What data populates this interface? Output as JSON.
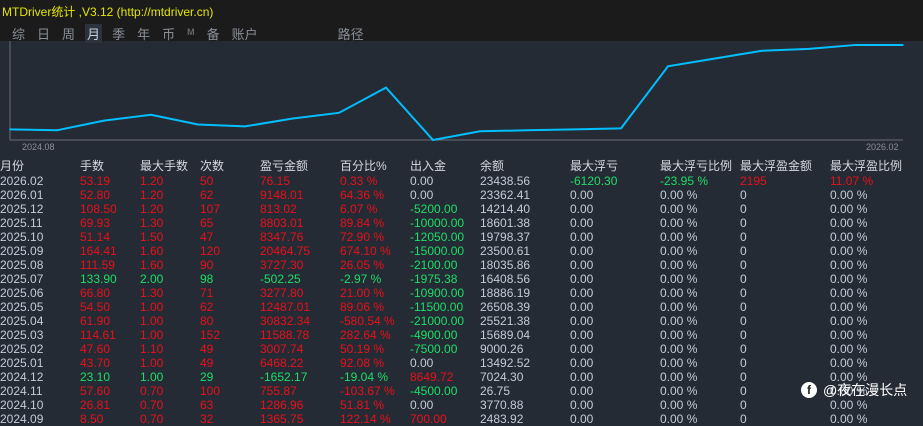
{
  "window": {
    "title": "MTDriver统计 ,V3.12 (http://mtdriver.cn)"
  },
  "nav": {
    "items": [
      "综",
      "日",
      "周",
      "月",
      "季",
      "年",
      "币",
      "M",
      "备",
      "账户"
    ],
    "active": "月",
    "path_label": "路径"
  },
  "chart_data": {
    "type": "line",
    "title": "",
    "x_start_label": "2024.08",
    "x_end_label": "2026.02",
    "series": [
      {
        "name": "balance-curve",
        "color": "#00bfff",
        "values": [
          11,
          10,
          20,
          26,
          16,
          14,
          22,
          28,
          54,
          0,
          9,
          10,
          11,
          12,
          76,
          84,
          92,
          94,
          98,
          98
        ]
      }
    ],
    "ylim": [
      0,
      100
    ]
  },
  "table": {
    "headers": [
      "月份",
      "手数",
      "最大手数",
      "次数",
      "盈亏金额",
      "百分比%",
      "出入金",
      "余额",
      "最大浮亏",
      "最大浮亏比例",
      "最大浮盈金额",
      "最大浮盈比例"
    ],
    "rows": [
      [
        [
          "2026.02",
          "n"
        ],
        [
          "53.19",
          "r"
        ],
        [
          "1.20",
          "r"
        ],
        [
          "50",
          "r"
        ],
        [
          "76.15",
          "r"
        ],
        [
          "0.33 %",
          "r"
        ],
        [
          "0.00",
          "n"
        ],
        [
          "23438.56",
          "n"
        ],
        [
          "-6120.30",
          "g"
        ],
        [
          "-23.95 %",
          "g"
        ],
        [
          "2195",
          "r"
        ],
        [
          "11.07 %",
          "r"
        ]
      ],
      [
        [
          "2026.01",
          "n"
        ],
        [
          "52.80",
          "r"
        ],
        [
          "1.20",
          "r"
        ],
        [
          "62",
          "r"
        ],
        [
          "9148.01",
          "r"
        ],
        [
          "64.36 %",
          "r"
        ],
        [
          "0.00",
          "n"
        ],
        [
          "23362.41",
          "n"
        ],
        [
          "0.00",
          "n"
        ],
        [
          "0.00 %",
          "n"
        ],
        [
          "0",
          "n"
        ],
        [
          "0.00 %",
          "n"
        ]
      ],
      [
        [
          "2025.12",
          "n"
        ],
        [
          "108.50",
          "r"
        ],
        [
          "1.20",
          "r"
        ],
        [
          "107",
          "r"
        ],
        [
          "813.02",
          "r"
        ],
        [
          "6.07 %",
          "r"
        ],
        [
          "-5200.00",
          "g"
        ],
        [
          "14214.40",
          "n"
        ],
        [
          "0.00",
          "n"
        ],
        [
          "0.00 %",
          "n"
        ],
        [
          "0",
          "n"
        ],
        [
          "0.00 %",
          "n"
        ]
      ],
      [
        [
          "2025.11",
          "n"
        ],
        [
          "69.93",
          "r"
        ],
        [
          "1.30",
          "r"
        ],
        [
          "65",
          "r"
        ],
        [
          "8803.01",
          "r"
        ],
        [
          "89.84 %",
          "r"
        ],
        [
          "-10000.00",
          "g"
        ],
        [
          "18601.38",
          "n"
        ],
        [
          "0.00",
          "n"
        ],
        [
          "0.00 %",
          "n"
        ],
        [
          "0",
          "n"
        ],
        [
          "0.00 %",
          "n"
        ]
      ],
      [
        [
          "2025.10",
          "n"
        ],
        [
          "51.14",
          "r"
        ],
        [
          "1.50",
          "r"
        ],
        [
          "47",
          "r"
        ],
        [
          "8347.76",
          "r"
        ],
        [
          "72.90 %",
          "r"
        ],
        [
          "-12050.00",
          "g"
        ],
        [
          "19798.37",
          "n"
        ],
        [
          "0.00",
          "n"
        ],
        [
          "0.00 %",
          "n"
        ],
        [
          "0",
          "n"
        ],
        [
          "0.00 %",
          "n"
        ]
      ],
      [
        [
          "2025.09",
          "n"
        ],
        [
          "164.41",
          "r"
        ],
        [
          "1.60",
          "r"
        ],
        [
          "120",
          "r"
        ],
        [
          "20464.75",
          "r"
        ],
        [
          "674.10 %",
          "r"
        ],
        [
          "-15000.00",
          "g"
        ],
        [
          "23500.61",
          "n"
        ],
        [
          "0.00",
          "n"
        ],
        [
          "0.00 %",
          "n"
        ],
        [
          "0",
          "n"
        ],
        [
          "0.00 %",
          "n"
        ]
      ],
      [
        [
          "2025.08",
          "n"
        ],
        [
          "111.59",
          "r"
        ],
        [
          "1.60",
          "r"
        ],
        [
          "90",
          "r"
        ],
        [
          "3727.30",
          "r"
        ],
        [
          "26.05 %",
          "r"
        ],
        [
          "-2100.00",
          "g"
        ],
        [
          "18035.86",
          "n"
        ],
        [
          "0.00",
          "n"
        ],
        [
          "0.00 %",
          "n"
        ],
        [
          "0",
          "n"
        ],
        [
          "0.00 %",
          "n"
        ]
      ],
      [
        [
          "2025.07",
          "n"
        ],
        [
          "133.90",
          "g"
        ],
        [
          "2.00",
          "g"
        ],
        [
          "98",
          "g"
        ],
        [
          "-502.25",
          "g"
        ],
        [
          "-2.97 %",
          "g"
        ],
        [
          "-1975.38",
          "g"
        ],
        [
          "16408.56",
          "n"
        ],
        [
          "0.00",
          "n"
        ],
        [
          "0.00 %",
          "n"
        ],
        [
          "0",
          "n"
        ],
        [
          "0.00 %",
          "n"
        ]
      ],
      [
        [
          "2025.06",
          "n"
        ],
        [
          "66.80",
          "r"
        ],
        [
          "1.30",
          "r"
        ],
        [
          "71",
          "r"
        ],
        [
          "3277.80",
          "r"
        ],
        [
          "21.00 %",
          "r"
        ],
        [
          "-10900.00",
          "g"
        ],
        [
          "18886.19",
          "n"
        ],
        [
          "0.00",
          "n"
        ],
        [
          "0.00 %",
          "n"
        ],
        [
          "0",
          "n"
        ],
        [
          "0.00 %",
          "n"
        ]
      ],
      [
        [
          "2025.05",
          "n"
        ],
        [
          "54.50",
          "r"
        ],
        [
          "1.00",
          "r"
        ],
        [
          "62",
          "r"
        ],
        [
          "12487.01",
          "r"
        ],
        [
          "89.06 %",
          "r"
        ],
        [
          "-11500.00",
          "g"
        ],
        [
          "26508.39",
          "n"
        ],
        [
          "0.00",
          "n"
        ],
        [
          "0.00 %",
          "n"
        ],
        [
          "0",
          "n"
        ],
        [
          "0.00 %",
          "n"
        ]
      ],
      [
        [
          "2025.04",
          "n"
        ],
        [
          "61.90",
          "r"
        ],
        [
          "1.00",
          "r"
        ],
        [
          "80",
          "r"
        ],
        [
          "30832.34",
          "r"
        ],
        [
          "-580.54 %",
          "r"
        ],
        [
          "-21000.00",
          "g"
        ],
        [
          "25521.38",
          "n"
        ],
        [
          "0.00",
          "n"
        ],
        [
          "0.00 %",
          "n"
        ],
        [
          "0",
          "n"
        ],
        [
          "0.00 %",
          "n"
        ]
      ],
      [
        [
          "2025.03",
          "n"
        ],
        [
          "114.61",
          "r"
        ],
        [
          "1.00",
          "r"
        ],
        [
          "152",
          "r"
        ],
        [
          "11588.78",
          "r"
        ],
        [
          "282.64 %",
          "r"
        ],
        [
          "-4900.00",
          "g"
        ],
        [
          "15689.04",
          "n"
        ],
        [
          "0.00",
          "n"
        ],
        [
          "0.00 %",
          "n"
        ],
        [
          "0",
          "n"
        ],
        [
          "0.00 %",
          "n"
        ]
      ],
      [
        [
          "2025.02",
          "n"
        ],
        [
          "47.60",
          "r"
        ],
        [
          "1.10",
          "r"
        ],
        [
          "49",
          "r"
        ],
        [
          "3007.74",
          "r"
        ],
        [
          "50.19 %",
          "r"
        ],
        [
          "-7500.00",
          "g"
        ],
        [
          "9000.26",
          "n"
        ],
        [
          "0.00",
          "n"
        ],
        [
          "0.00 %",
          "n"
        ],
        [
          "0",
          "n"
        ],
        [
          "0.00 %",
          "n"
        ]
      ],
      [
        [
          "2025.01",
          "n"
        ],
        [
          "43.70",
          "r"
        ],
        [
          "1.00",
          "r"
        ],
        [
          "49",
          "r"
        ],
        [
          "6468.22",
          "r"
        ],
        [
          "92.08 %",
          "r"
        ],
        [
          "0.00",
          "n"
        ],
        [
          "13492.52",
          "n"
        ],
        [
          "0.00",
          "n"
        ],
        [
          "0.00 %",
          "n"
        ],
        [
          "0",
          "n"
        ],
        [
          "0.00 %",
          "n"
        ]
      ],
      [
        [
          "2024.12",
          "n"
        ],
        [
          "23.10",
          "g"
        ],
        [
          "1.00",
          "g"
        ],
        [
          "29",
          "g"
        ],
        [
          "-1652.17",
          "g"
        ],
        [
          "-19.04 %",
          "g"
        ],
        [
          "8649.72",
          "r"
        ],
        [
          "7024.30",
          "n"
        ],
        [
          "0.00",
          "n"
        ],
        [
          "0.00 %",
          "n"
        ],
        [
          "0",
          "n"
        ],
        [
          "0.00 %",
          "n"
        ]
      ],
      [
        [
          "2024.11",
          "n"
        ],
        [
          "57.60",
          "r"
        ],
        [
          "0.70",
          "r"
        ],
        [
          "100",
          "r"
        ],
        [
          "755.87",
          "r"
        ],
        [
          "-103.67 %",
          "r"
        ],
        [
          "-4500.00",
          "g"
        ],
        [
          "26.75",
          "n"
        ],
        [
          "0.00",
          "n"
        ],
        [
          "0.00 %",
          "n"
        ],
        [
          "0",
          "n"
        ],
        [
          "0.00 %",
          "n"
        ]
      ],
      [
        [
          "2024.10",
          "n"
        ],
        [
          "26.81",
          "r"
        ],
        [
          "0.70",
          "r"
        ],
        [
          "63",
          "r"
        ],
        [
          "1286.96",
          "r"
        ],
        [
          "51.81 %",
          "r"
        ],
        [
          "0.00",
          "n"
        ],
        [
          "3770.88",
          "n"
        ],
        [
          "0.00",
          "n"
        ],
        [
          "0.00 %",
          "n"
        ],
        [
          "0",
          "n"
        ],
        [
          "0.00 %",
          "n"
        ]
      ],
      [
        [
          "2024.09",
          "n"
        ],
        [
          "8.50",
          "r"
        ],
        [
          "0.70",
          "r"
        ],
        [
          "32",
          "r"
        ],
        [
          "1365.75",
          "r"
        ],
        [
          "122.14 %",
          "r"
        ],
        [
          "700.00",
          "r"
        ],
        [
          "2483.92",
          "n"
        ],
        [
          "0.00",
          "n"
        ],
        [
          "0.00 %",
          "n"
        ],
        [
          "0",
          "n"
        ],
        [
          "0.00 %",
          "n"
        ]
      ]
    ]
  },
  "watermark": {
    "text": "@夜在漫长点",
    "icon": "facebook-icon"
  }
}
